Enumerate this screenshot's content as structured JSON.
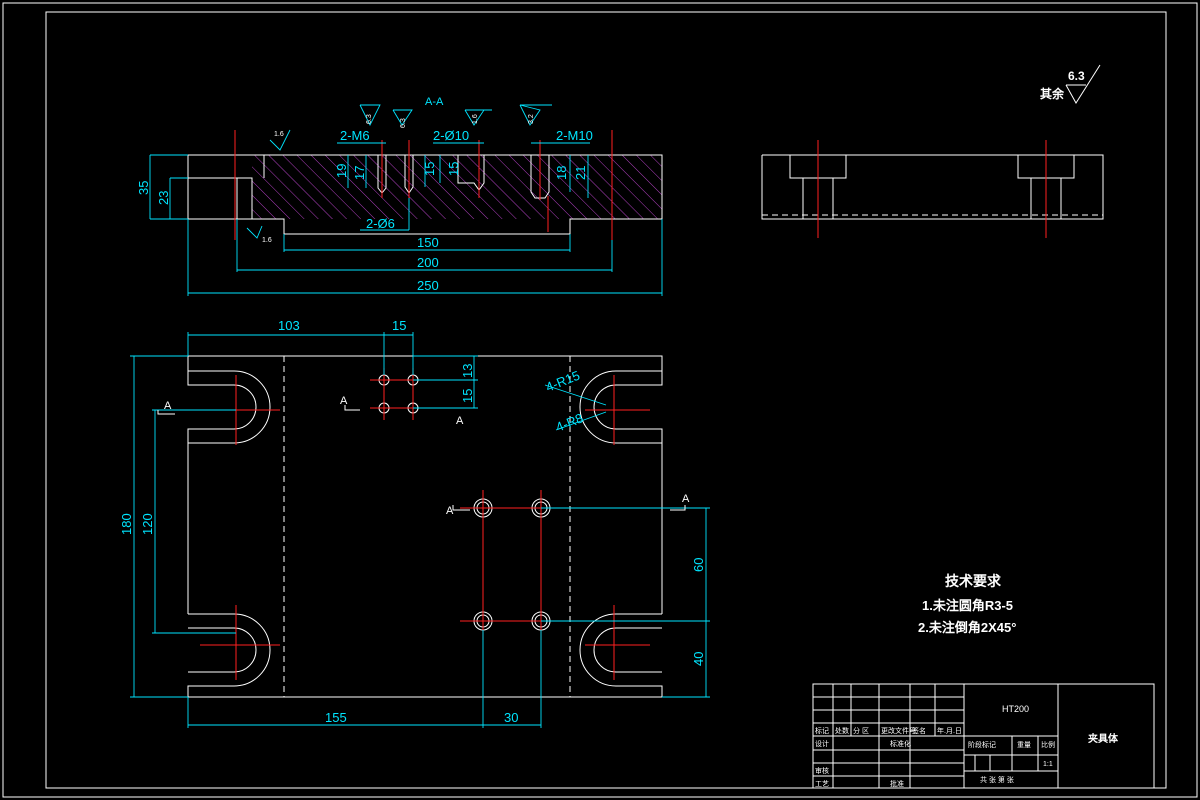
{
  "section_label": "A-A",
  "surface_roughness": {
    "general_value": "6.3",
    "general_label": "其余",
    "marks": [
      "1.6",
      "6.3",
      "6.3",
      "1.6",
      "3.2",
      "1.6"
    ]
  },
  "front_view": {
    "dims": {
      "m6": "2-M6",
      "phi10": "2-Ø10",
      "m10": "2-M10",
      "phi6": "2-Ø6",
      "h35": "35",
      "h23": "23",
      "d19": "19",
      "d17": "17",
      "d15a": "15",
      "d15b": "15",
      "d21": "21",
      "d18": "18",
      "w150": "150",
      "w200": "200",
      "w250": "250"
    }
  },
  "top_view": {
    "dims": {
      "x103": "103",
      "x15": "15",
      "y13": "13",
      "y15": "15",
      "r15": "4-R15",
      "r8": "4-R8",
      "h180": "180",
      "h120": "120",
      "y60": "60",
      "y40": "40",
      "x155": "155",
      "x30": "30"
    },
    "section_marks": [
      "A",
      "A",
      "A",
      "A",
      "A"
    ]
  },
  "tech_req": {
    "title": "技术要求",
    "items": [
      "1.未注圆角R3-5",
      "2.未注倒角2X45°"
    ]
  },
  "title_block": {
    "material": "HT200",
    "part_name": "夹具体",
    "scale": "1:1",
    "headers": [
      "标记",
      "处数",
      "分 区",
      "更改文件号",
      "签名",
      "年.月.日"
    ],
    "rows": [
      "设计",
      "审核",
      "工艺"
    ],
    "std_label": "标准化",
    "approve_label": "批准",
    "stage_label": "阶段标记",
    "weight_label": "重量",
    "ratio_label": "比例",
    "sheets": "共  张  第  张"
  }
}
